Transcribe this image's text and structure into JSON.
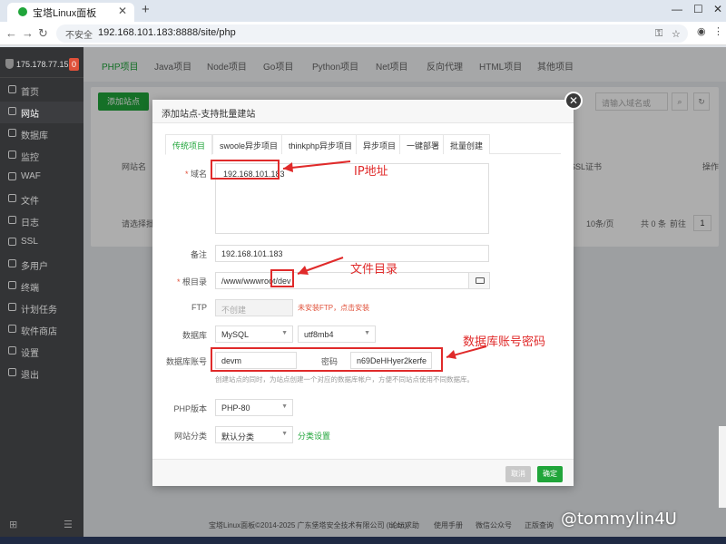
{
  "browser": {
    "tab_title": "宝塔Linux面板",
    "insecure_label": "不安全",
    "url": "192.168.101.183:8888/site/php"
  },
  "sidebar": {
    "ip": "175.178.77.159",
    "badge": "0",
    "items": [
      {
        "label": "首页"
      },
      {
        "label": "网站"
      },
      {
        "label": "数据库"
      },
      {
        "label": "监控"
      },
      {
        "label": "WAF"
      },
      {
        "label": "文件"
      },
      {
        "label": "日志"
      },
      {
        "label": "SSL"
      },
      {
        "label": "多用户"
      },
      {
        "label": "终端"
      },
      {
        "label": "计划任务"
      },
      {
        "label": "软件商店"
      },
      {
        "label": "设置"
      },
      {
        "label": "退出"
      }
    ]
  },
  "main": {
    "tabs": [
      "PHP项目",
      "Java项目",
      "Node项目",
      "Go项目",
      "Python项目",
      "Net项目",
      "反向代理",
      "HTML项目",
      "其他项目"
    ],
    "add_site": "添加站点",
    "search_placeholder": "请输入域名或",
    "col_site": "网站名",
    "col_ssl": "SSL证书",
    "col_ops": "操作",
    "batch_placeholder": "请选择批量",
    "per_page": "10条/页",
    "total": "共 0 条",
    "goto": "前往",
    "page": "1",
    "footer_copy": "宝塔Linux面板©2014-2025 广东堡塔安全技术有限公司 (bt.cn)",
    "footer_links": [
      "论坛求助",
      "使用手册",
      "微信公众号",
      "正版查询"
    ]
  },
  "modal": {
    "title": "添加站点-支持批量建站",
    "tabs": [
      "传统项目",
      "swoole异步项目",
      "thinkphp异步项目",
      "异步项目",
      "一键部署",
      "批量创建"
    ],
    "domain_label": "域名",
    "domain_value": "192.168.101.183",
    "remark_label": "备注",
    "remark_value": "192.168.101.183",
    "root_label": "根目录",
    "root_value": "/www/wwwroot/dev",
    "ftp_label": "FTP",
    "ftp_value": "不创建",
    "ftp_warn": "未安装FTP，点击安装",
    "db_label": "数据库",
    "db_type": "MySQL",
    "db_charset": "utf8mb4",
    "dbacct_label": "数据库账号",
    "dbacct_value": "devm",
    "pwd_label": "密码",
    "pwd_value": "n69DeHHyer2kerfe",
    "db_hint": "创建站点的同时，为站点创建一个对应的数据库帐户，方便不同站点使用不同数据库。",
    "php_label": "PHP版本",
    "php_value": "PHP-80",
    "cat_label": "网站分类",
    "cat_value": "默认分类",
    "cat_link": "分类设置",
    "cancel": "取消",
    "ok": "确定"
  },
  "annotations": {
    "ip": "IP地址",
    "dir": "文件目录",
    "db": "数据库账号密码"
  },
  "watermark": "@tommylin4U",
  "colors": {
    "accent": "#20a53a",
    "annotation": "#e02a2a",
    "sidebar": "#333436"
  }
}
